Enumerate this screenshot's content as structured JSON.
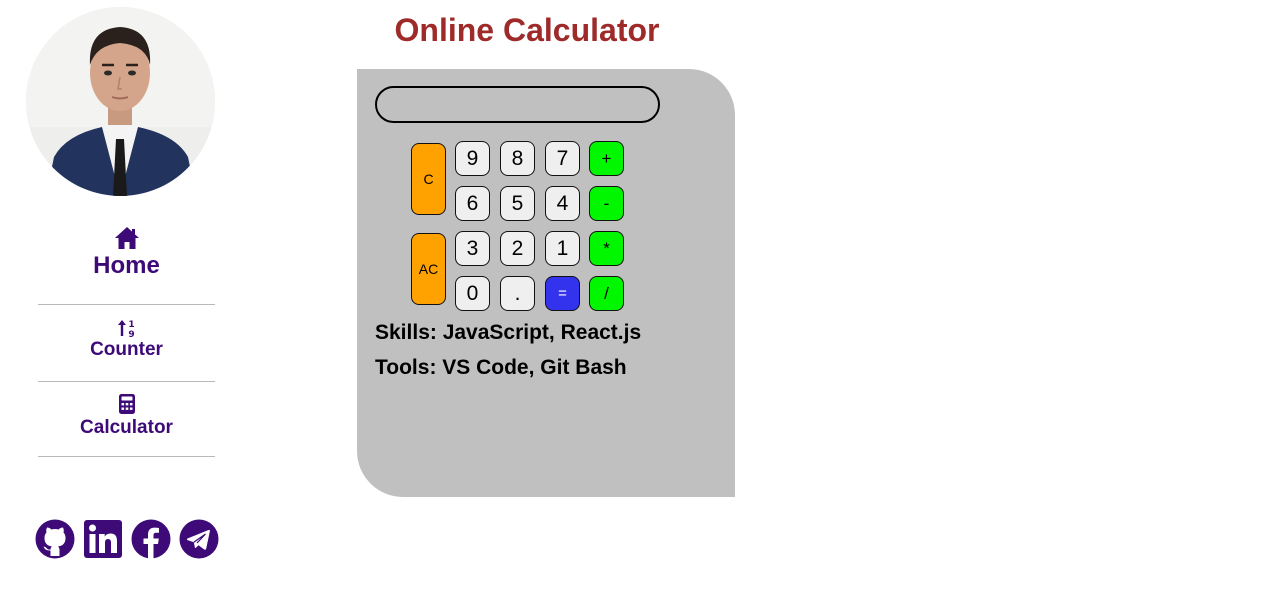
{
  "sidebar": {
    "avatar_alt": "profile-photo",
    "nav": [
      {
        "label": "Home",
        "icon": "home-icon"
      },
      {
        "label": "Counter",
        "icon": "sort-arrows-icon"
      },
      {
        "label": "Calculator",
        "icon": "calculator-icon"
      }
    ],
    "social": [
      {
        "icon": "github-icon"
      },
      {
        "icon": "linkedin-icon"
      },
      {
        "icon": "facebook-icon"
      },
      {
        "icon": "telegram-icon"
      }
    ]
  },
  "main": {
    "title": "Online Calculator",
    "display": {
      "value": ""
    },
    "keys": {
      "clear": "C",
      "all_clear": "AC",
      "row1": [
        "9",
        "8",
        "7",
        "+"
      ],
      "row2": [
        "6",
        "5",
        "4",
        "-"
      ],
      "row3": [
        "3",
        "2",
        "1",
        "*"
      ],
      "row4": [
        "0",
        ".",
        "=",
        "/"
      ]
    },
    "skills": "Skills: JavaScript, React.js",
    "tools": "Tools: VS Code, Git Bash"
  },
  "colors": {
    "nav_text": "#3d0a78",
    "title": "#9e2a2a",
    "panel": "#c0c0c0",
    "clear_keys": "#ffa200",
    "operator_keys": "#00f700",
    "equals_key": "#3333ee"
  }
}
